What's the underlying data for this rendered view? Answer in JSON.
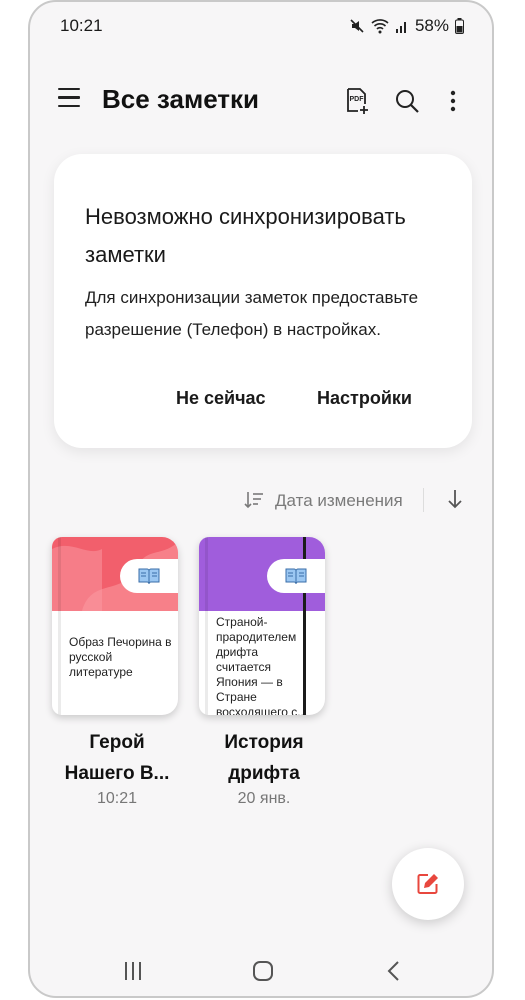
{
  "status": {
    "time": "10:21",
    "battery": "58%"
  },
  "appbar": {
    "title": "Все заметки",
    "pdf_icon_label": "PDF"
  },
  "sync_card": {
    "title": "Невозможно синхронизировать заметки",
    "body": "Для синхронизации заметок предоставьте разрешение (Телефон) в настройках.",
    "not_now": "Не сейчас",
    "settings": "Настройки"
  },
  "sort": {
    "label": "Дата изменения"
  },
  "notes": [
    {
      "title": "Герой Нашего В...",
      "date": "10:21",
      "cover_text": "Образ Печорина в русской литературе",
      "cover_color": "#f25f6c"
    },
    {
      "title": "История дрифта",
      "date": "20 янв.",
      "cover_text": "Страной-прародителем дрифта считается Япония — в Стране восходящего с...",
      "cover_color": "#a05ddc"
    }
  ],
  "colors": {
    "fab_accent": "#e8473e",
    "background": "#f7f6f7"
  }
}
